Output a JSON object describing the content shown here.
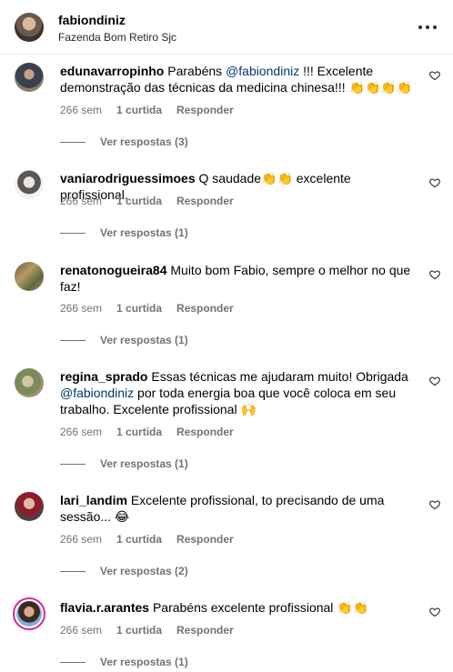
{
  "header": {
    "username": "fabiondiniz",
    "location": "Fazenda Bom Retiro Sjc"
  },
  "comments": [
    {
      "username": "edunavarropinho",
      "pre": "Parabéns ",
      "mention": "@fabiondiniz",
      "post": " !!! Excelente demonstração das técnicas da medicina chinesa!!! 👏👏👏👏",
      "time": "266 sem",
      "likes": "1 curtida",
      "reply": "Responder",
      "replies": "Ver respostas (3)"
    },
    {
      "username": "vaniarodriguessimoes",
      "pre": "Q saudade👏👏 excelente profissional.",
      "mention": "",
      "post": "",
      "time": "266 sem",
      "likes": "1 curtida",
      "reply": "Responder",
      "replies": "Ver respostas (1)"
    },
    {
      "username": "renatonogueira84",
      "pre": "Muito bom Fabio, sempre o melhor no que faz!",
      "mention": "",
      "post": "",
      "time": "266 sem",
      "likes": "1 curtida",
      "reply": "Responder",
      "replies": "Ver respostas (1)"
    },
    {
      "username": "regina_sprado",
      "pre": "Essas técnicas me ajudaram muito! Obrigada ",
      "mention": "@fabiondiniz",
      "post": " por toda energia boa que você coloca em seu trabalho. Excelente profissional 🙌",
      "time": "266 sem",
      "likes": "1 curtida",
      "reply": "Responder",
      "replies": "Ver respostas (1)"
    },
    {
      "username": "lari_landim",
      "pre": "Excelente profissional, to precisando de uma sessão... 😂",
      "mention": "",
      "post": "",
      "time": "266 sem",
      "likes": "1 curtida",
      "reply": "Responder",
      "replies": "Ver respostas (2)"
    },
    {
      "username": "flavia.r.arantes",
      "pre": "Parabéns excelente profissional 👏👏",
      "mention": "",
      "post": "",
      "time": "266 sem",
      "likes": "1 curtida",
      "reply": "Responder",
      "replies": "Ver respostas (1)"
    }
  ]
}
